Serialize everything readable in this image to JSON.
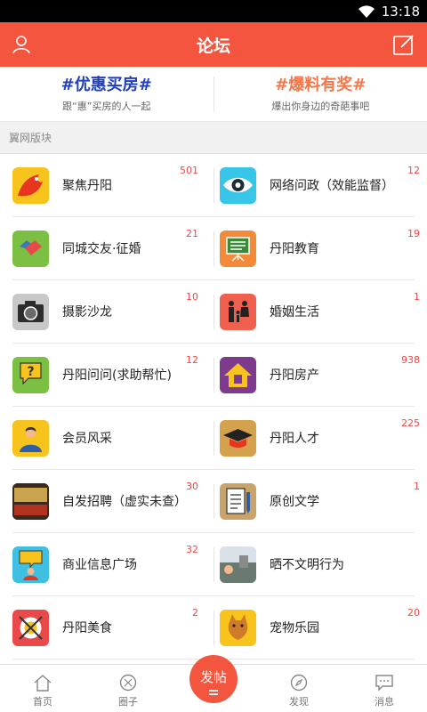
{
  "status": {
    "time": "13:18"
  },
  "header": {
    "title": "论坛",
    "user_icon": "user-icon",
    "compose_icon": "compose-icon"
  },
  "promo": [
    {
      "title": "#优惠买房#",
      "subtitle": "跟“惠”买房的人一起",
      "color": "#1f3fbd"
    },
    {
      "title": "#爆料有奖#",
      "subtitle": "爆出你身边的奇葩事吧",
      "color": "#f4774a"
    }
  ],
  "section": {
    "title": "翼网版块"
  },
  "boards": [
    [
      {
        "label": "聚焦丹阳",
        "count": "501",
        "icon": "phoenix-icon"
      },
      {
        "label": "网络问政（效能监督）",
        "count": "12",
        "icon": "eye-icon"
      }
    ],
    [
      {
        "label": "同城交友·征婚",
        "count": "21",
        "icon": "handshake-icon"
      },
      {
        "label": "丹阳教育",
        "count": "19",
        "icon": "blackboard-icon"
      }
    ],
    [
      {
        "label": "摄影沙龙",
        "count": "10",
        "icon": "camera-icon"
      },
      {
        "label": "婚姻生活",
        "count": "1",
        "icon": "family-icon"
      }
    ],
    [
      {
        "label": "丹阳问问(求助帮忙)",
        "count": "12",
        "icon": "question-icon"
      },
      {
        "label": "丹阳房产",
        "count": "938",
        "icon": "house-icon"
      }
    ],
    [
      {
        "label": "会员风采",
        "count": "",
        "icon": "member-icon"
      },
      {
        "label": "丹阳人才",
        "count": "225",
        "icon": "graduate-icon"
      }
    ],
    [
      {
        "label": "自发招聘（虚实未查）",
        "count": "30",
        "icon": "recruit-icon"
      },
      {
        "label": "原创文学",
        "count": "1",
        "icon": "document-icon"
      }
    ],
    [
      {
        "label": "商业信息广场",
        "count": "32",
        "icon": "chat-person-icon"
      },
      {
        "label": "晒不文明行为",
        "count": "",
        "icon": "photo-icon"
      }
    ],
    [
      {
        "label": "丹阳美食",
        "count": "2",
        "icon": "food-icon"
      },
      {
        "label": "宠物乐园",
        "count": "20",
        "icon": "pet-icon"
      }
    ]
  ],
  "tabs": [
    {
      "label": "首页",
      "icon": "home-icon"
    },
    {
      "label": "圈子",
      "icon": "circle-icon"
    },
    {
      "label": "发帖",
      "icon": "post-icon"
    },
    {
      "label": "发现",
      "icon": "compass-icon"
    },
    {
      "label": "消息",
      "icon": "message-icon"
    }
  ],
  "colors": {
    "accent": "#f4553f",
    "count": "#f04848"
  }
}
